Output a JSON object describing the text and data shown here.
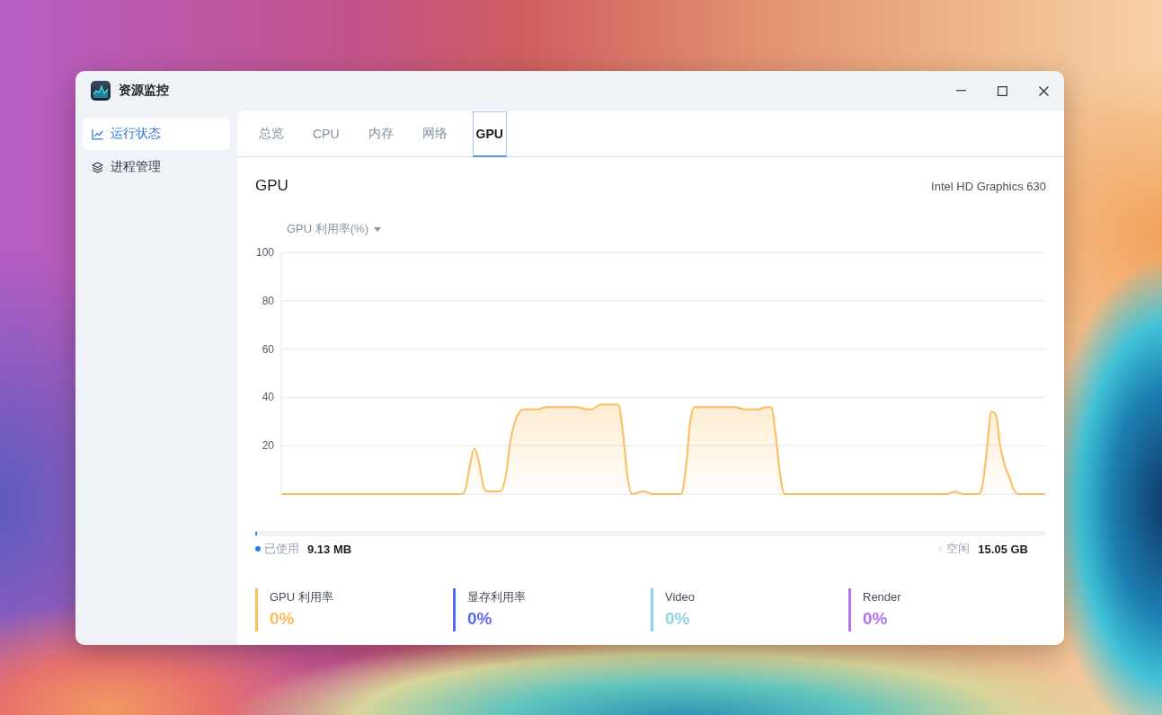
{
  "window": {
    "title": "资源监控"
  },
  "sidebar": {
    "items": [
      {
        "label": "运行状态",
        "selected": true
      },
      {
        "label": "进程管理",
        "selected": false
      }
    ]
  },
  "tabs": [
    {
      "label": "总览",
      "selected": false
    },
    {
      "label": "CPU",
      "selected": false
    },
    {
      "label": "内存",
      "selected": false
    },
    {
      "label": "网络",
      "selected": false
    },
    {
      "label": "GPU",
      "selected": true
    }
  ],
  "gpu_panel": {
    "title": "GPU",
    "device": "Intel HD Graphics 630",
    "metric_dropdown": {
      "label": "GPU 利用率(%)"
    },
    "chart_data": {
      "type": "area",
      "grid": true,
      "ylim": [
        0,
        100
      ],
      "yticks": [
        20,
        40,
        60,
        80,
        100
      ],
      "values": [
        0,
        0,
        0,
        0,
        0,
        0,
        0,
        0,
        0,
        0,
        0,
        0,
        0,
        0,
        0,
        0,
        0,
        0,
        0,
        0,
        0,
        0,
        0,
        0,
        0,
        0,
        0,
        0,
        0,
        0,
        0,
        0,
        0,
        0,
        0,
        0,
        0,
        0,
        0,
        0,
        0,
        2,
        12,
        19,
        13,
        3,
        1,
        1,
        1,
        1.5,
        8,
        22,
        30,
        34,
        35,
        35,
        35,
        35,
        35.5,
        36,
        36,
        36,
        36,
        36,
        36,
        36,
        36,
        35.5,
        35,
        35,
        36,
        37,
        37,
        37,
        37,
        37,
        26,
        8,
        0,
        0.3,
        1,
        1,
        0.3,
        0,
        0,
        0,
        0,
        0,
        0,
        0,
        10,
        30,
        36,
        36,
        36,
        36,
        36,
        36,
        36,
        36,
        36,
        36,
        35.5,
        35,
        35,
        35,
        35,
        35.5,
        36,
        36,
        25,
        8,
        0,
        0,
        0,
        0,
        0,
        0,
        0,
        0,
        0,
        0,
        0,
        0,
        0,
        0,
        0,
        0,
        0,
        0,
        0,
        0,
        0,
        0,
        0,
        0,
        0,
        0,
        0,
        0,
        0,
        0,
        0,
        0,
        0,
        0,
        0,
        0,
        0,
        0.5,
        1,
        0.3,
        0,
        0,
        0,
        0,
        3,
        18,
        34,
        33,
        20,
        12,
        7,
        2,
        0,
        0,
        0,
        0,
        0,
        0,
        0
      ]
    },
    "memory": {
      "level": 0.002,
      "used_label": "已使用",
      "used_value": "9.13 MB",
      "free_label": "空闲",
      "free_value": "15.05 GB"
    },
    "stats": [
      {
        "label": "GPU 利用率",
        "value": "0%",
        "color": "#fbbd5e"
      },
      {
        "label": "显存利用率",
        "value": "0%",
        "color": "#5b67f7"
      },
      {
        "label": "Video",
        "value": "0%",
        "color": "#8dd4e8"
      },
      {
        "label": "Render",
        "value": "0%",
        "color": "#b274f6"
      }
    ]
  }
}
